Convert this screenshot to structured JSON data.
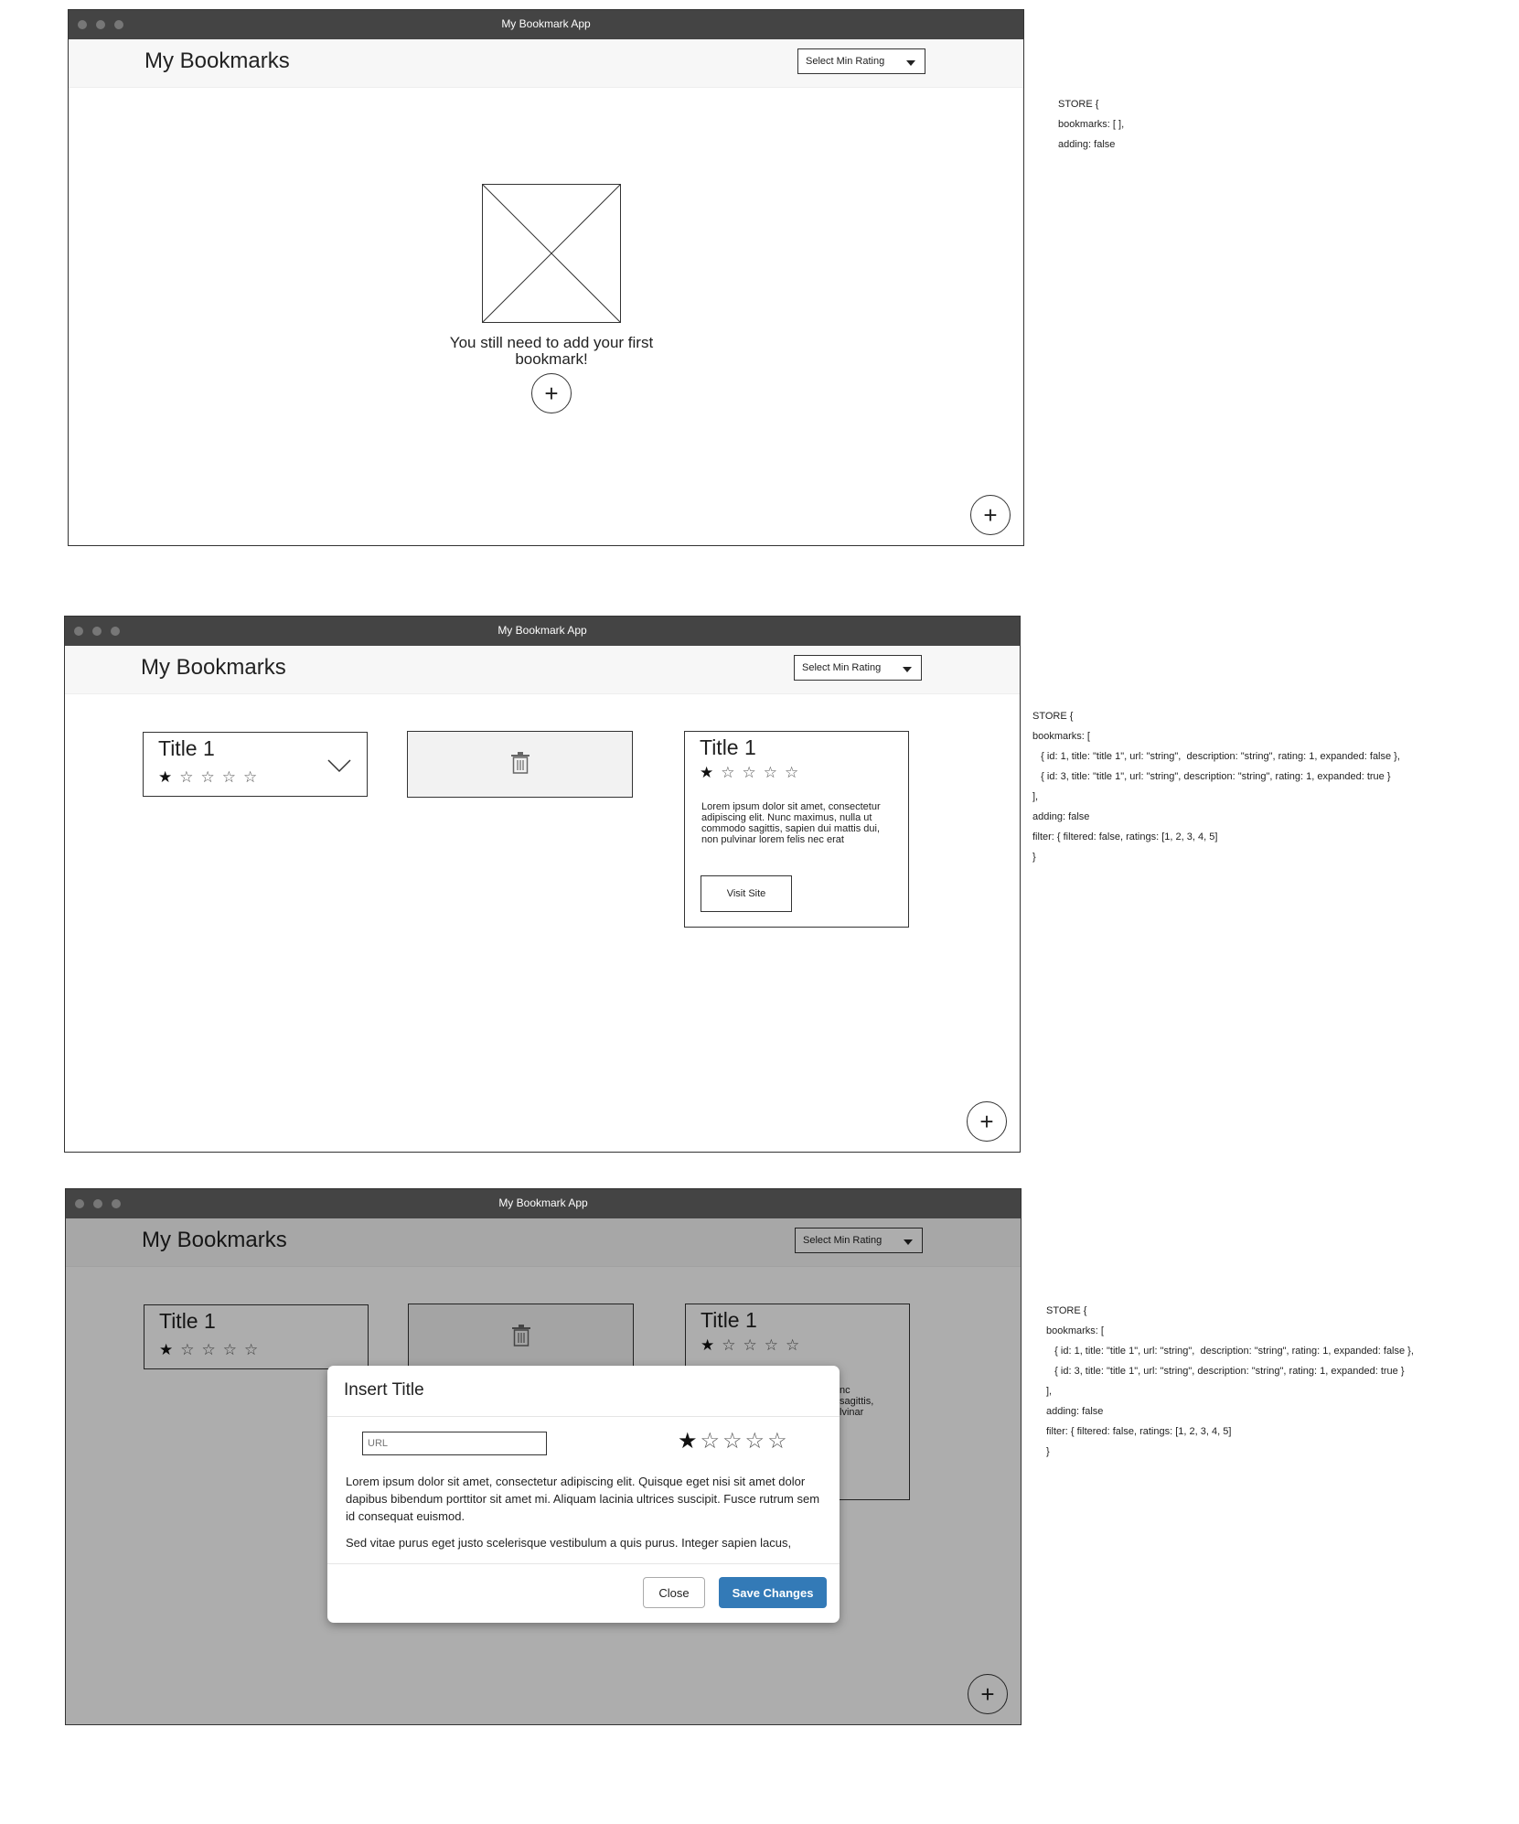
{
  "app": {
    "window_title": "My Bookmark App",
    "title": "My Bookmarks",
    "filter_label": "Select Min Rating",
    "add_symbol": "+"
  },
  "screen1": {
    "empty_message": "You still need to add your first bookmark!",
    "store_lines": [
      "STORE {",
      "bookmarks: [ ],",
      "adding: false"
    ]
  },
  "screen2": {
    "collapsed_card": {
      "title": "Title 1",
      "rating": 1,
      "max_rating": 5
    },
    "expanded_card": {
      "title": "Title 1",
      "rating": 1,
      "max_rating": 5,
      "description": "Lorem ipsum dolor sit amet, consectetur adipiscing elit. Nunc maximus, nulla ut commodo sagittis, sapien dui mattis dui, non pulvinar lorem felis nec erat",
      "visit_label": "Visit Site"
    },
    "store_lines": [
      "STORE {",
      "bookmarks: [",
      "   { id: 1, title: \"title 1\", url: \"string\",  description: \"string\", rating: 1, expanded: false },",
      "   { id: 3, title: \"title 1\", url: \"string\", description: \"string\", rating: 1, expanded: true }",
      "],",
      "adding: false",
      "filter: { filtered: false, ratings: [1, 2, 3, 4, 5]",
      "}"
    ]
  },
  "screen3": {
    "modal": {
      "title": "Insert Title",
      "url_placeholder": "URL",
      "rating": 1,
      "max_rating": 5,
      "paragraph1": "Lorem ipsum dolor sit amet, consectetur adipiscing elit. Quisque eget nisi sit amet dolor dapibus bibendum porttitor sit amet mi. Aliquam lacinia ultrices suscipit. Fusce rutrum sem id consequat euismod.",
      "paragraph2": "Sed vitae purus eget justo scelerisque vestibulum a quis purus. Integer sapien lacus,",
      "close_label": "Close",
      "save_label": "Save Changes"
    },
    "bg_card_fragment": "nc\nsagittis,\nlvinar",
    "store_lines": [
      "STORE {",
      "bookmarks: [",
      "   { id: 1, title: \"title 1\", url: \"string\",  description: \"string\", rating: 1, expanded: false },",
      "   { id: 3, title: \"title 1\", url: \"string\", description: \"string\", rating: 1, expanded: true }",
      "],",
      "adding: false",
      "filter: { filtered: false, ratings: [1, 2, 3, 4, 5]",
      "}"
    ]
  },
  "icons": [
    "trash-icon",
    "chevron-down-icon",
    "plus-icon",
    "star-icon",
    "image-placeholder-icon"
  ]
}
